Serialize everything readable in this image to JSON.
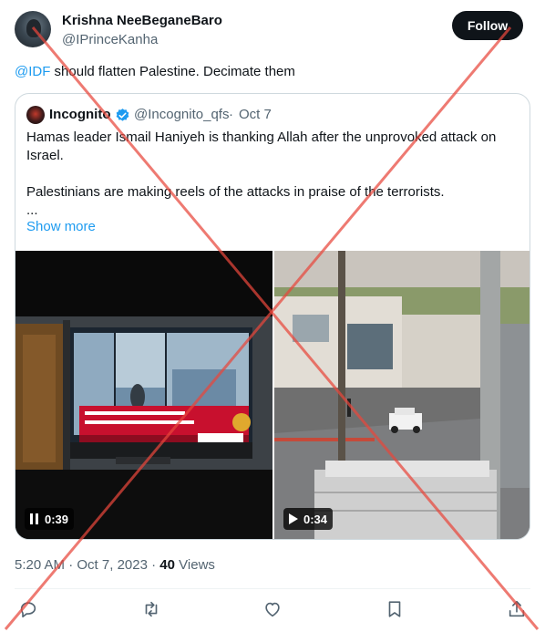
{
  "tweet": {
    "display_name": "Krishna NeeBeganeBaro",
    "handle": "@IPrinceKanha",
    "follow_label": "Follow",
    "text_mention": "@IDF",
    "text_body": " should flatten Palestine. Decimate them",
    "time": "5:20 AM",
    "separator": " · ",
    "date": "Oct 7, 2023",
    "view_count": "40",
    "views_label": "Views"
  },
  "quote": {
    "display_name": "Incognito",
    "handle": "@Incognito_qfs",
    "separator": "·",
    "date": "Oct 7",
    "line1": "Hamas leader Ismail Haniyeh is thanking Allah after the unprovoked attack on",
    "line2": "Israel.",
    "line3": "Palestinians are making reels of the attacks in praise of the terrorists.",
    "line4": "...",
    "show_more": "Show more",
    "videos": [
      {
        "duration": "0:39",
        "control_icon": "pause-icon",
        "banner_label": "عاجل",
        "channel": "الجزيرة"
      },
      {
        "duration": "0:34",
        "control_icon": "play-icon"
      }
    ]
  },
  "colors": {
    "accent": "#1d9bf0",
    "text_primary": "#0f1419",
    "text_secondary": "#536471",
    "overlay_cross": "#e8463c",
    "news_banner": "#c8102e"
  },
  "actions": [
    "reply-icon",
    "retweet-icon",
    "like-icon",
    "bookmark-icon",
    "share-icon"
  ]
}
